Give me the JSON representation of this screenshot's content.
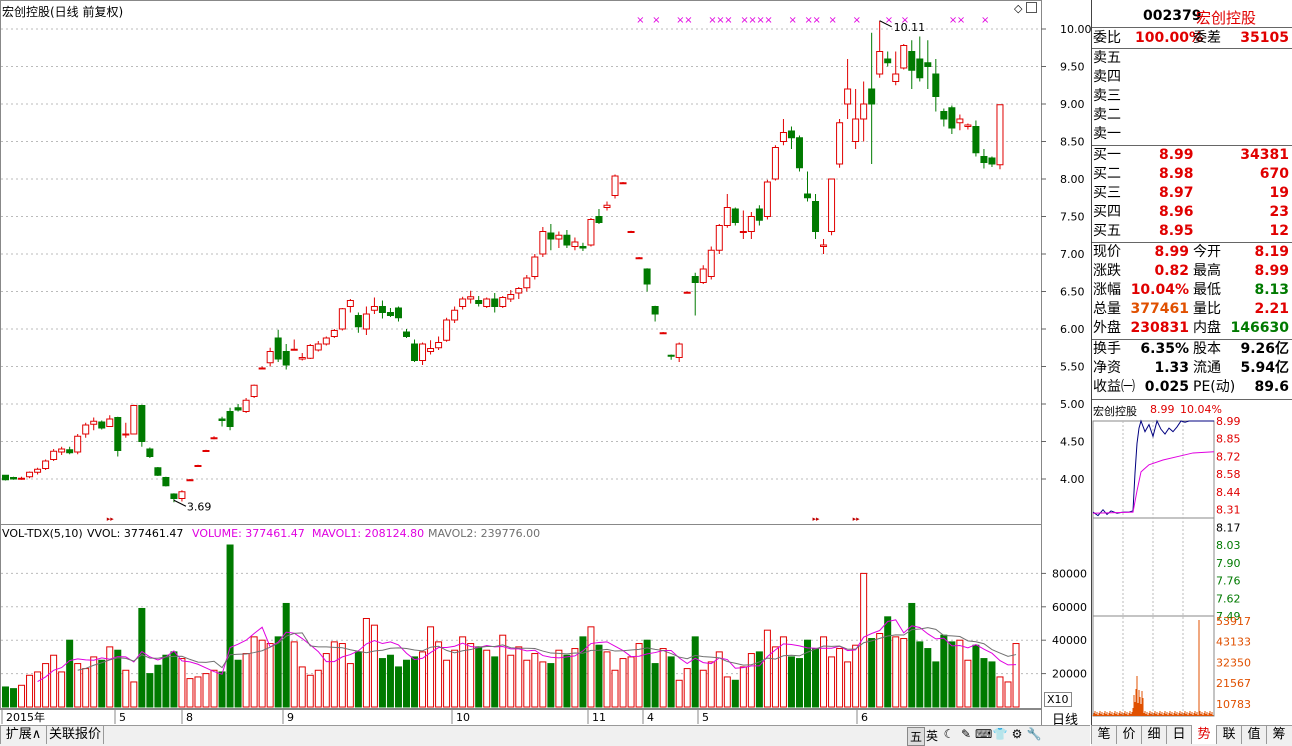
{
  "header": {
    "title": "宏创控股(日线 前复权)",
    "stock_code": "002379",
    "stock_name": "宏创控股"
  },
  "colors": {
    "up": "#e00000",
    "down": "#007a00",
    "ma1": "#e000e0",
    "ma2": "#707070",
    "intraday_line": "#000080",
    "intraday_avg": "#e000e0",
    "minute_vol": "#e05000"
  },
  "kline": {
    "y_ticks": [
      "10.00",
      "9.50",
      "9.00",
      "8.50",
      "8.00",
      "7.50",
      "7.00",
      "6.50",
      "6.00",
      "5.50",
      "5.00",
      "4.50",
      "4.00"
    ],
    "y_tick_values": [
      10,
      9.5,
      9,
      8.5,
      8,
      7.5,
      7,
      6.5,
      6,
      5.5,
      5,
      4.5,
      4
    ],
    "high_label": "10.11",
    "low_label": "3.69",
    "x_labels": [
      "2015年",
      "5",
      "8",
      "9",
      "10",
      "11",
      "4",
      "5",
      "6"
    ],
    "candles": [
      [
        4.05,
        4.05,
        3.98,
        3.99
      ],
      [
        4.02,
        4.03,
        3.99,
        4.0
      ],
      [
        4.01,
        4.03,
        3.99,
        4.01
      ],
      [
        4.03,
        4.1,
        4.01,
        4.09
      ],
      [
        4.09,
        4.15,
        4.06,
        4.13
      ],
      [
        4.14,
        4.26,
        4.12,
        4.24
      ],
      [
        4.26,
        4.4,
        4.24,
        4.37
      ],
      [
        4.36,
        4.43,
        4.32,
        4.4
      ],
      [
        4.39,
        4.43,
        4.33,
        4.35
      ],
      [
        4.36,
        4.6,
        4.33,
        4.57
      ],
      [
        4.6,
        4.75,
        4.55,
        4.72
      ],
      [
        4.73,
        4.82,
        4.65,
        4.77
      ],
      [
        4.76,
        4.78,
        4.66,
        4.68
      ],
      [
        4.7,
        4.85,
        4.7,
        4.8
      ],
      [
        4.82,
        4.83,
        4.3,
        4.38
      ],
      [
        4.6,
        4.75,
        4.55,
        4.6
      ],
      [
        4.6,
        4.99,
        4.6,
        4.98
      ],
      [
        4.98,
        4.99,
        4.43,
        4.5
      ],
      [
        4.4,
        4.42,
        4.28,
        4.3
      ],
      [
        4.15,
        4.16,
        4.04,
        4.05
      ],
      [
        4.02,
        4.03,
        3.9,
        3.91
      ],
      [
        3.8,
        3.81,
        3.69,
        3.74
      ],
      [
        3.74,
        3.85,
        3.7,
        3.83
      ],
      [
        3.99,
        4.0,
        3.98,
        3.99
      ],
      [
        4.18,
        4.19,
        4.17,
        4.18
      ],
      [
        4.38,
        4.39,
        4.37,
        4.38
      ],
      [
        4.55,
        4.57,
        4.53,
        4.55
      ],
      [
        4.8,
        4.83,
        4.7,
        4.78
      ],
      [
        4.9,
        4.95,
        4.65,
        4.7
      ],
      [
        4.95,
        5.0,
        4.9,
        4.92
      ],
      [
        4.9,
        5.08,
        4.88,
        5.05
      ],
      [
        5.1,
        5.26,
        5.08,
        5.25
      ],
      [
        5.48,
        5.5,
        5.46,
        5.48
      ],
      [
        5.55,
        5.75,
        5.5,
        5.7
      ],
      [
        5.88,
        5.99,
        5.56,
        5.6
      ],
      [
        5.7,
        5.8,
        5.46,
        5.52
      ],
      [
        5.72,
        5.86,
        5.72,
        5.73
      ],
      [
        5.6,
        5.68,
        5.58,
        5.62
      ],
      [
        5.61,
        5.8,
        5.6,
        5.78
      ],
      [
        5.72,
        5.84,
        5.7,
        5.8
      ],
      [
        5.8,
        5.9,
        5.78,
        5.88
      ],
      [
        5.9,
        6.0,
        5.88,
        5.98
      ],
      [
        6.0,
        6.28,
        5.98,
        6.27
      ],
      [
        6.3,
        6.4,
        6.22,
        6.38
      ],
      [
        6.18,
        6.22,
        5.95,
        6.03
      ],
      [
        6.0,
        6.3,
        5.92,
        6.2
      ],
      [
        6.25,
        6.42,
        6.2,
        6.3
      ],
      [
        6.3,
        6.38,
        6.14,
        6.22
      ],
      [
        6.22,
        6.28,
        6.16,
        6.18
      ],
      [
        6.28,
        6.3,
        6.1,
        6.15
      ],
      [
        5.96,
        6.0,
        5.88,
        5.9
      ],
      [
        5.8,
        5.86,
        5.56,
        5.58
      ],
      [
        5.58,
        5.82,
        5.52,
        5.8
      ],
      [
        5.7,
        5.85,
        5.66,
        5.74
      ],
      [
        5.75,
        5.9,
        5.72,
        5.82
      ],
      [
        5.85,
        6.15,
        5.83,
        6.12
      ],
      [
        6.12,
        6.3,
        6.08,
        6.25
      ],
      [
        6.3,
        6.43,
        6.26,
        6.4
      ],
      [
        6.4,
        6.51,
        6.34,
        6.43
      ],
      [
        6.38,
        6.44,
        6.3,
        6.34
      ],
      [
        6.3,
        6.42,
        6.28,
        6.4
      ],
      [
        6.4,
        6.48,
        6.22,
        6.3
      ],
      [
        6.3,
        6.44,
        6.28,
        6.42
      ],
      [
        6.4,
        6.52,
        6.36,
        6.46
      ],
      [
        6.48,
        6.56,
        6.4,
        6.54
      ],
      [
        6.55,
        6.72,
        6.5,
        6.68
      ],
      [
        6.7,
        7.0,
        6.66,
        6.96
      ],
      [
        7.0,
        7.36,
        6.96,
        7.3
      ],
      [
        7.28,
        7.4,
        7.05,
        7.2
      ],
      [
        7.2,
        7.3,
        7.08,
        7.25
      ],
      [
        7.25,
        7.32,
        7.08,
        7.12
      ],
      [
        7.1,
        7.22,
        7.05,
        7.16
      ],
      [
        7.1,
        7.15,
        7.04,
        7.08
      ],
      [
        7.12,
        7.48,
        7.1,
        7.46
      ],
      [
        7.5,
        7.6,
        7.4,
        7.42
      ],
      [
        7.62,
        7.7,
        7.58,
        7.65
      ],
      [
        7.78,
        8.06,
        7.74,
        8.04
      ],
      [
        7.95,
        7.96,
        7.94,
        7.95
      ],
      [
        7.3,
        7.31,
        7.29,
        7.3
      ],
      [
        6.95,
        6.96,
        6.94,
        6.95
      ],
      [
        6.8,
        6.81,
        6.5,
        6.6
      ],
      [
        6.3,
        6.31,
        6.1,
        6.2
      ],
      [
        5.95,
        5.96,
        5.94,
        5.95
      ],
      [
        5.65,
        5.66,
        5.59,
        5.64
      ],
      [
        5.62,
        5.82,
        5.56,
        5.8
      ],
      [
        6.49,
        6.5,
        6.48,
        6.49
      ],
      [
        6.7,
        6.75,
        6.18,
        6.62
      ],
      [
        6.62,
        6.85,
        6.6,
        6.8
      ],
      [
        6.7,
        7.1,
        6.66,
        7.05
      ],
      [
        7.05,
        7.4,
        7.0,
        7.38
      ],
      [
        7.38,
        7.8,
        7.35,
        7.62
      ],
      [
        7.6,
        7.62,
        7.38,
        7.42
      ],
      [
        7.3,
        7.58,
        7.2,
        7.3
      ],
      [
        7.3,
        7.56,
        7.2,
        7.5
      ],
      [
        7.6,
        7.65,
        7.38,
        7.45
      ],
      [
        7.5,
        7.99,
        7.46,
        7.96
      ],
      [
        8.0,
        8.45,
        7.98,
        8.42
      ],
      [
        8.5,
        8.8,
        8.45,
        8.62
      ],
      [
        8.64,
        8.7,
        8.4,
        8.55
      ],
      [
        8.55,
        8.58,
        8.1,
        8.15
      ],
      [
        7.8,
        8.1,
        7.7,
        7.75
      ],
      [
        7.7,
        7.8,
        7.2,
        7.3
      ],
      [
        7.1,
        7.2,
        7.0,
        7.12
      ],
      [
        7.3,
        8.0,
        7.25,
        8.0
      ],
      [
        8.2,
        8.8,
        8.15,
        8.75
      ],
      [
        9.0,
        9.6,
        8.8,
        9.2
      ],
      [
        8.5,
        9.2,
        8.4,
        8.8
      ],
      [
        8.8,
        9.3,
        8.5,
        9.0
      ],
      [
        9.2,
        9.95,
        8.2,
        9.0
      ],
      [
        9.4,
        10.11,
        9.35,
        9.7
      ],
      [
        9.6,
        9.7,
        9.5,
        9.55
      ],
      [
        9.3,
        9.7,
        9.25,
        9.4
      ],
      [
        9.48,
        9.8,
        9.46,
        9.78
      ],
      [
        9.7,
        9.85,
        9.2,
        9.45
      ],
      [
        9.6,
        9.9,
        9.3,
        9.35
      ],
      [
        9.55,
        9.85,
        9.2,
        9.5
      ],
      [
        9.4,
        9.6,
        8.9,
        9.1
      ],
      [
        8.9,
        8.94,
        8.7,
        8.8
      ],
      [
        8.95,
        8.98,
        8.6,
        8.68
      ],
      [
        8.75,
        8.86,
        8.65,
        8.8
      ],
      [
        8.7,
        8.74,
        8.66,
        8.72
      ],
      [
        8.7,
        8.78,
        8.3,
        8.35
      ],
      [
        8.3,
        8.4,
        8.14,
        8.22
      ],
      [
        8.28,
        8.3,
        8.16,
        8.2
      ],
      [
        8.19,
        8.99,
        8.13,
        8.99
      ]
    ]
  },
  "volume": {
    "label_name": "VOL-TDX(5,10)",
    "vvol": "VVOL: 377461.47",
    "volume_text": "VOLUME: 377461.47",
    "mavol1": "MAVOL1: 208124.80",
    "mavol2": "MAVOL2: 239776.00",
    "y_ticks": [
      "80000",
      "60000",
      "40000",
      "20000"
    ],
    "y_tick_values": [
      80000,
      60000,
      40000,
      20000
    ],
    "unit": "X10",
    "values": [
      12000,
      11000,
      13000,
      19000,
      21000,
      26000,
      31000,
      21000,
      40000,
      26000,
      23000,
      30000,
      28000,
      36000,
      34000,
      22000,
      15000,
      59000,
      20000,
      25000,
      31000,
      33000,
      29000,
      17000,
      18000,
      20000,
      22000,
      21000,
      97000,
      28000,
      32000,
      42000,
      40000,
      38000,
      42000,
      62000,
      39000,
      24000,
      19000,
      22000,
      32000,
      39000,
      38000,
      26000,
      33000,
      53000,
      49000,
      29000,
      31000,
      24000,
      28000,
      30000,
      33000,
      48000,
      39000,
      28000,
      34000,
      42000,
      38000,
      36000,
      34000,
      30000,
      43000,
      31000,
      36000,
      28000,
      32000,
      27000,
      26000,
      34000,
      31000,
      35000,
      42000,
      48000,
      37000,
      33000,
      22000,
      29000,
      30000,
      38000,
      40000,
      26000,
      35000,
      30000,
      16000,
      23000,
      42000,
      22000,
      27000,
      33000,
      18000,
      16000,
      24000,
      32000,
      33000,
      46000,
      36000,
      42000,
      30000,
      29000,
      40000,
      35000,
      42000,
      30000,
      35000,
      27000,
      37000,
      80000,
      41000,
      44000,
      54000,
      42000,
      41000,
      62000,
      39000,
      35000,
      27000,
      43000,
      39000,
      40000,
      28000,
      37000,
      29000,
      27000,
      18000,
      15000,
      38000
    ]
  },
  "quote": {
    "weibi_label": "委比",
    "weibi_value": "100.00%",
    "weicha_label": "委差",
    "weicha_value": "35105",
    "sells": [
      {
        "label": "卖五",
        "price": "",
        "vol": ""
      },
      {
        "label": "卖四",
        "price": "",
        "vol": ""
      },
      {
        "label": "卖三",
        "price": "",
        "vol": ""
      },
      {
        "label": "卖二",
        "price": "",
        "vol": ""
      },
      {
        "label": "卖一",
        "price": "",
        "vol": ""
      }
    ],
    "buys": [
      {
        "label": "买一",
        "price": "8.99",
        "vol": "34381"
      },
      {
        "label": "买二",
        "price": "8.98",
        "vol": "670"
      },
      {
        "label": "买三",
        "price": "8.97",
        "vol": "19"
      },
      {
        "label": "买四",
        "price": "8.96",
        "vol": "23"
      },
      {
        "label": "买五",
        "price": "8.95",
        "vol": "12"
      }
    ],
    "stats": [
      {
        "l1": "现价",
        "v1": "8.99",
        "c1": "#e00000",
        "l2": "今开",
        "v2": "8.19",
        "c2": "#e00000"
      },
      {
        "l1": "涨跌",
        "v1": "0.82",
        "c1": "#e00000",
        "l2": "最高",
        "v2": "8.99",
        "c2": "#e00000"
      },
      {
        "l1": "涨幅",
        "v1": "10.04%",
        "c1": "#e00000",
        "l2": "最低",
        "v2": "8.13",
        "c2": "#007a00"
      },
      {
        "l1": "总量",
        "v1": "377461",
        "c1": "#e05000",
        "l2": "量比",
        "v2": "2.21",
        "c2": "#e00000"
      },
      {
        "l1": "外盘",
        "v1": "230831",
        "c1": "#e00000",
        "l2": "内盘",
        "v2": "146630",
        "c2": "#007a00"
      }
    ],
    "fund": [
      {
        "l1": "换手",
        "v1": "6.35%",
        "l2": "股本",
        "v2": "9.26亿"
      },
      {
        "l1": "净资",
        "v1": "1.33",
        "l2": "流通",
        "v2": "5.94亿"
      },
      {
        "l1": "收益㈠",
        "v1": "0.025",
        "l2": "PE(动)",
        "v2": "89.6"
      }
    ]
  },
  "intraday": {
    "title": "宏创控股",
    "price": "8.99",
    "pct": "10.04%",
    "price_ticks": [
      "8.99",
      "8.85",
      "8.72",
      "8.58",
      "8.44",
      "8.31",
      "8.17",
      "8.03",
      "7.90",
      "7.76",
      "7.62",
      "7.49"
    ],
    "vol_ticks": [
      "53917",
      "43133",
      "32350",
      "21567",
      "10783"
    ]
  },
  "bottom": {
    "left_tabs": [
      "扩展∧",
      "关联报价"
    ],
    "period": "日线",
    "toolbar": [
      "五",
      "英",
      "☾",
      "✎",
      "⌨",
      "👕",
      "⚙",
      "🔧"
    ],
    "right_tabs": [
      "笔",
      "价",
      "细",
      "日",
      "势",
      "联",
      "值",
      "筹"
    ],
    "active_right_tab": "势"
  }
}
